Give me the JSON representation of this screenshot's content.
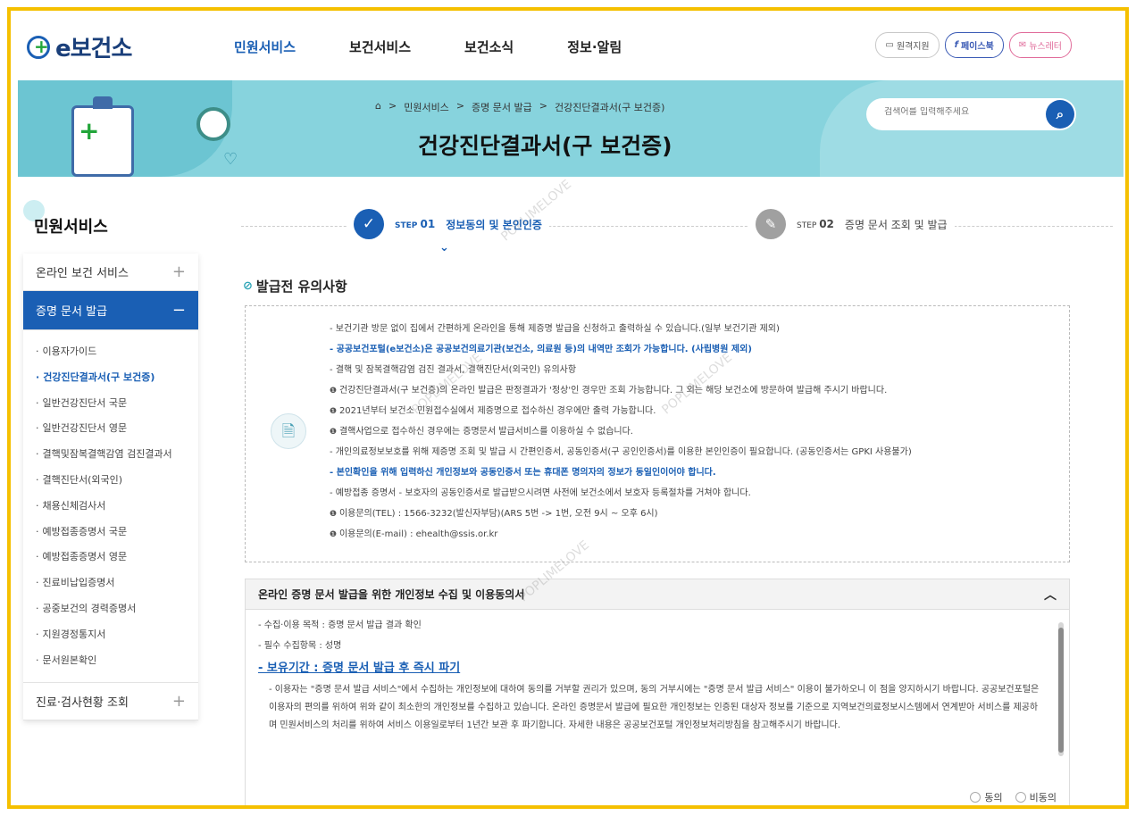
{
  "header": {
    "logo": "e보건소",
    "nav": [
      "민원서비스",
      "보건서비스",
      "보건소식",
      "정보·알림"
    ],
    "util": [
      "원격지원",
      "페이스북",
      "뉴스레터"
    ]
  },
  "banner": {
    "breadcrumb": [
      "⌂",
      ">",
      "민원서비스",
      ">",
      "증명 문서 발급",
      ">",
      "건강진단결과서(구 보건증)"
    ],
    "title": "건강진단결과서(구 보건증)",
    "search_placeholder": "검색어를 입력해주세요"
  },
  "sidebar": {
    "title": "민원서비스",
    "sections": [
      {
        "label": "온라인 보건 서비스",
        "toggle": "+"
      },
      {
        "label": "증명 문서 발급",
        "toggle": "−"
      },
      {
        "label": "진료·검사현황 조회",
        "toggle": "+"
      }
    ],
    "items": [
      "이용자가이드",
      "건강진단결과서(구 보건증)",
      "일반건강진단서 국문",
      "일반건강진단서 영문",
      "결핵및잠복결핵감염 검진결과서",
      "결핵진단서(외국인)",
      "채용신체검사서",
      "예방접종증명서 국문",
      "예방접종증명서 영문",
      "진료비납입증명서",
      "공중보건의 경력증명서",
      "지원경정통지서",
      "문서원본확인"
    ],
    "current_index": 1
  },
  "steps": {
    "step1": {
      "num": "01",
      "prefix": "STEP",
      "label": "정보동의 및 본인인증"
    },
    "step2": {
      "num": "02",
      "prefix": "STEP",
      "label": "증명 문서 조회 및 발급"
    }
  },
  "notice": {
    "title": "발급전 유의사항",
    "lines": [
      {
        "style": "dash",
        "text": "보건기관 방문 없이 집에서 간편하게 온라인을 통해 제증명 발급을 신청하고 출력하실 수 있습니다.(일부 보건기관 제외)"
      },
      {
        "style": "dash b",
        "text": "공공보건포털(e보건소)은 공공보건의료기관(보건소, 의료원 등)의 내역만 조회가 가능합니다. (사립병원 제외)"
      },
      {
        "style": "dash",
        "text": "결핵 및 잠복결핵감염 검진 결과서, 결핵진단서(외국인) 유의사항"
      },
      {
        "style": "cav",
        "text": "건강진단결과서(구 보건증)의 온라인 발급은 판정결과가 '정상'인 경우만 조회 가능합니다. 그 외는 해당 보건소에 방문하여 발급해 주시기 바랍니다."
      },
      {
        "style": "cav",
        "text": "2021년부터 보건소 민원접수실에서 제증명으로 접수하신 경우에만 출력 가능합니다."
      },
      {
        "style": "cav",
        "text": "결핵사업으로 접수하신 경우에는 증명문서 발급서비스를 이용하실 수 없습니다."
      },
      {
        "style": "dash",
        "text": "개인의료정보보호를 위해 제증명 조회 및 발급 시 간편인증서, 공동인증서(구 공인인증서)를 이용한 본인인증이 필요합니다. (공동인증서는 GPKI 사용불가)"
      },
      {
        "style": "dash b",
        "text": "본인확인을 위해 입력하신 개인정보와 공동인증서 또는 휴대폰 명의자의 정보가 동일인이어야 합니다."
      },
      {
        "style": "dash",
        "text": "예방접종 증명서 - 보호자의 공동인증서로 발급받으시려면 사전에 보건소에서 보호자 등록절차를 거쳐야 합니다."
      },
      {
        "style": "cav",
        "text": "이용문의(TEL) : 1566-3232(발신자부담)(ARS 5번 -> 1번, 오전 9시 ~ 오후 6시)"
      },
      {
        "style": "cav",
        "text": "이용문의(E-mail) : ehealth@ssis.or.kr"
      }
    ]
  },
  "consent": {
    "title": "온라인 증명 문서 발급을 위한 개인정보 수집 및 이용동의서",
    "purpose": "- 수집·이용 목적 : 증명 문서 발급 결과 확인",
    "required": "- 필수 수집항목 : 성명",
    "retention": "- 보유기간 : 증명 문서 발급 후 즉시 파기",
    "para": "- 이용자는 \"증명 문서 발급 서비스\"에서 수집하는 개인정보에 대하여 동의를 거부할 권리가 있으며, 동의 거부시에는 \"증명 문서 발급 서비스\" 이용이 불가하오니 이 점을 양지하시기 바랍니다. 공공보건포털은 이용자의 편의를 위하여 위와 같이 최소한의 개인정보를 수집하고 있습니다. 온라인 증명문서 발급에 필요한 개인정보는 인증된 대상자 정보를 기준으로 지역보건의료정보시스템에서 연계받아 서비스를 제공하며 민원서비스의 처리를 위하여 서비스 이용일로부터 1년간 보관 후 파기합니다. 자세한 내용은 공공보건포털 개인정보처리방침을 참고해주시기 바랍니다.",
    "agree": "동의",
    "disagree": "비동의"
  },
  "watermark": "POPLIMELOVE",
  "colors": {
    "primary": "#1a5fb4",
    "frame": "#f5c000",
    "banner": "#87d3dd"
  }
}
